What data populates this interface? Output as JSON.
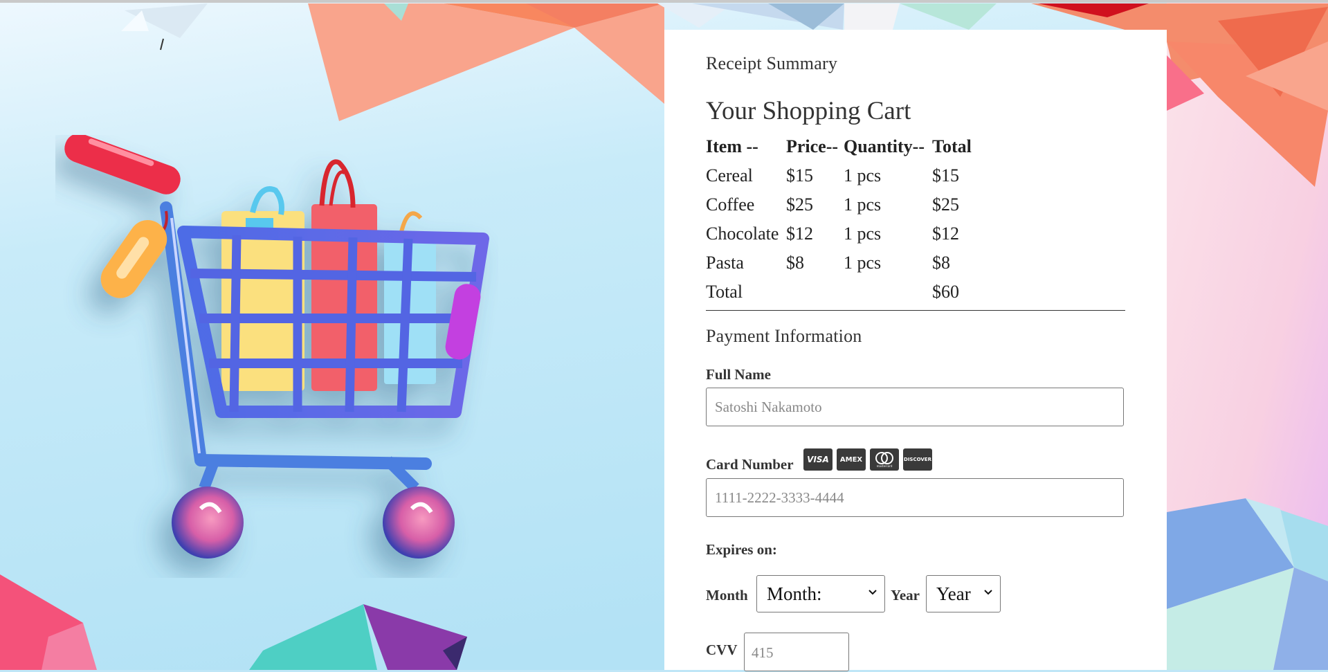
{
  "receipt": {
    "summary_title": "Receipt Summary",
    "cart_title": "Your Shopping Cart",
    "headers": [
      "Item --",
      "Price--",
      "Quantity--",
      "Total"
    ],
    "items": [
      {
        "name": "Cereal",
        "price": "$15",
        "qty": "1 pcs",
        "total": "$15"
      },
      {
        "name": "Coffee",
        "price": "$25",
        "qty": "1 pcs",
        "total": "$25"
      },
      {
        "name": "Chocolate",
        "price": "$12",
        "qty": "1 pcs",
        "total": "$12"
      },
      {
        "name": "Pasta",
        "price": "$8",
        "qty": "1 pcs",
        "total": "$8"
      }
    ],
    "total_label": "Total",
    "total_value": "$60"
  },
  "payment": {
    "title": "Payment Information",
    "full_name_label": "Full Name",
    "full_name_placeholder": "Satoshi Nakamoto",
    "card_number_label": "Card Number",
    "card_number_placeholder": "1111-2222-3333-4444",
    "card_brands": [
      "VISA",
      "AMEX",
      "mastercard",
      "DISCOVER"
    ],
    "expires_label": "Expires on:",
    "month_label": "Month",
    "month_value": "Month:",
    "year_label": "Year",
    "year_value": "Year",
    "cvv_label": "CVV",
    "cvv_placeholder": "415"
  },
  "icons": [
    "shopping-cart-illustration",
    "visa-icon",
    "amex-icon",
    "mastercard-icon",
    "discover-icon",
    "chevron-down-icon"
  ],
  "colors": {
    "panel": "#ffffff",
    "sky": "#bfe6f7",
    "coral": "#f7806a",
    "cart_blue": "#5566e0"
  }
}
